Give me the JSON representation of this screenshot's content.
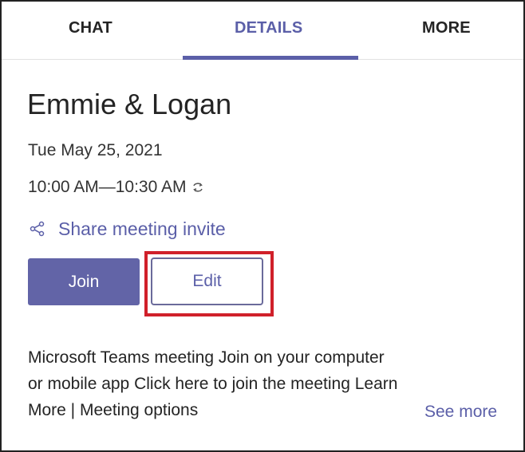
{
  "tabs": {
    "chat": "CHAT",
    "details": "DETAILS",
    "more": "MORE",
    "active": "DETAILS"
  },
  "meeting": {
    "title": "Emmie & Logan",
    "date": "Tue May 25, 2021",
    "time": "10:00 AM—10:30 AM",
    "recurring_icon": "repeat-icon"
  },
  "share": {
    "icon": "share-icon",
    "label": "Share meeting invite"
  },
  "buttons": {
    "join_label": "Join",
    "edit_label": "Edit"
  },
  "description": {
    "lines": [
      "Microsoft Teams meeting Join on your computer",
      "or mobile app Click here to join the meeting Learn",
      "More | Meeting options"
    ],
    "see_more": "See more"
  },
  "colors": {
    "accent": "#6264a7",
    "accent_text": "#5b5fa8",
    "highlight": "#d0202a"
  }
}
